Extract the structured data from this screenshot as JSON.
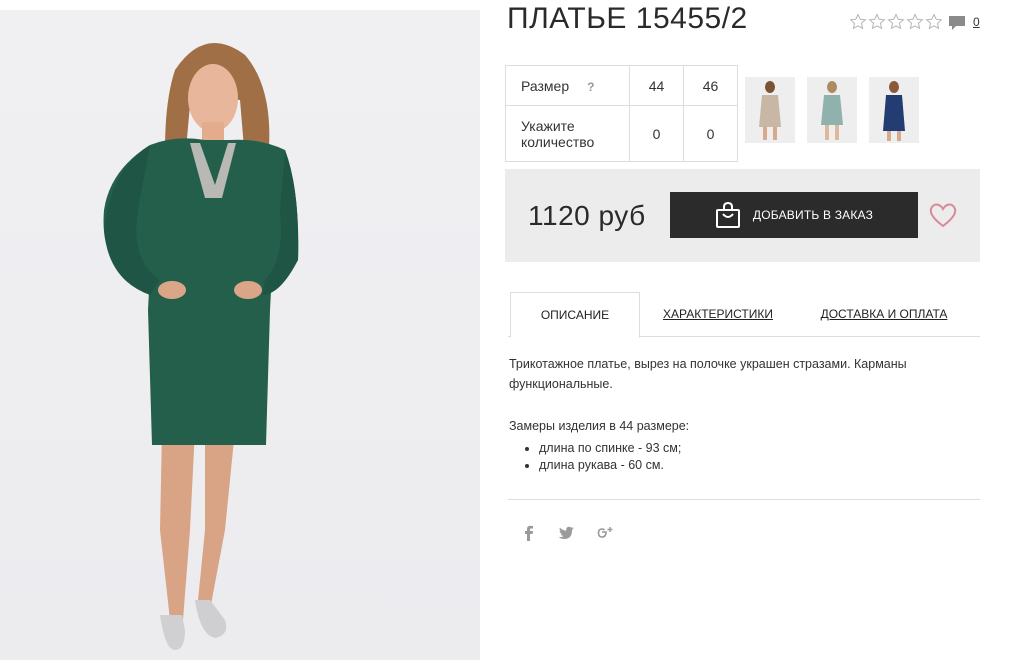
{
  "product": {
    "title": "ПЛАТЬЕ 15455/2",
    "rating": 0,
    "rating_max": 5,
    "comment_count": "0"
  },
  "size_table": {
    "size_label": "Размер",
    "help": "?",
    "sizes": [
      "44",
      "46"
    ],
    "qty_label": "Укажите количество",
    "quantities": [
      "0",
      "0"
    ]
  },
  "thumbnails": [
    {
      "color": "#c9b7a6",
      "name": "beige"
    },
    {
      "color": "#8fb2ac",
      "name": "mint"
    },
    {
      "color": "#233d73",
      "name": "navy"
    }
  ],
  "purchase": {
    "price": "1120 руб",
    "add_button": "ДОБАВИТЬ В ЗАКАЗ"
  },
  "tabs": [
    {
      "label": "ОПИСАНИЕ",
      "active": true
    },
    {
      "label": "ХАРАКТЕРИСТИКИ",
      "active": false
    },
    {
      "label": "ДОСТАВКА И ОПЛАТА",
      "active": false
    }
  ],
  "description": {
    "text": "Трикотажное платье, вырез на полочке украшен стразами. Карманы функциональные.",
    "measure_title": "Замеры изделия в 44 размере:",
    "measures": [
      "длина по спинке - 93 см;",
      "длина рукава - 60 см."
    ]
  },
  "social": [
    "facebook-icon",
    "twitter-icon",
    "google-plus-icon"
  ],
  "colors": {
    "dress_green": "#245f4c",
    "heart": "#d9899a",
    "button_bg": "#2b2b2b"
  }
}
